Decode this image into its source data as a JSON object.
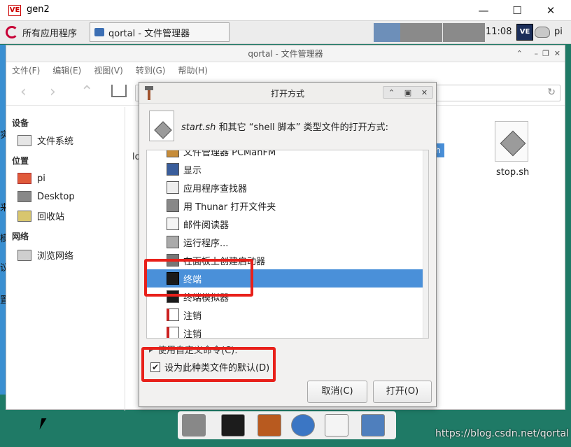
{
  "vnc": {
    "logo": "VE",
    "title": "gen2",
    "minimize": "—",
    "maximize": "☐",
    "close": "✕"
  },
  "taskbar": {
    "menu_label": "所有应用程序",
    "task_label": "qortal - 文件管理器",
    "clock": "11:08",
    "tray_logo": "VE",
    "user": "pi"
  },
  "file_manager": {
    "title": "qortal - 文件管理器",
    "menu": [
      "文件(F)",
      "编辑(E)",
      "视图(V)",
      "转到(G)",
      "帮助(H)"
    ],
    "sidebar": {
      "devices_header": "设备",
      "filesystem": "文件系统",
      "places_header": "位置",
      "home": "pi",
      "desktop": "Desktop",
      "trash": "回收站",
      "network_header": "网络",
      "browse_network": "浏览网络"
    },
    "files": {
      "partial_left": "lo",
      "partial_selected": "h",
      "stop": "stop.sh"
    }
  },
  "left_edge_chars": [
    "实",
    "来",
    "模",
    "议",
    "置"
  ],
  "dialog": {
    "title": "打开方式",
    "file_name": "start.sh",
    "description": " 和其它 “shell 脚本” 类型文件的打开方式:",
    "apps": [
      "文件管理器 PCManFM",
      "显示",
      "应用程序查找器",
      "用 Thunar 打开文件夹",
      "邮件阅读器",
      "运行程序...",
      "在面板上创建启动器",
      "终端",
      "终端模拟器",
      "注销",
      "注销"
    ],
    "selected_index": 7,
    "custom_command": "使用自定义命令(C):",
    "default_checkbox": "设为此种类文件的默认(D)",
    "default_checked": true,
    "cancel": "取消(C)",
    "open": "打开(O)"
  },
  "watermark": "https://blog.csdn.net/qortal",
  "colors": {
    "highlight": "#e8201a",
    "selection": "#4a90d9"
  }
}
